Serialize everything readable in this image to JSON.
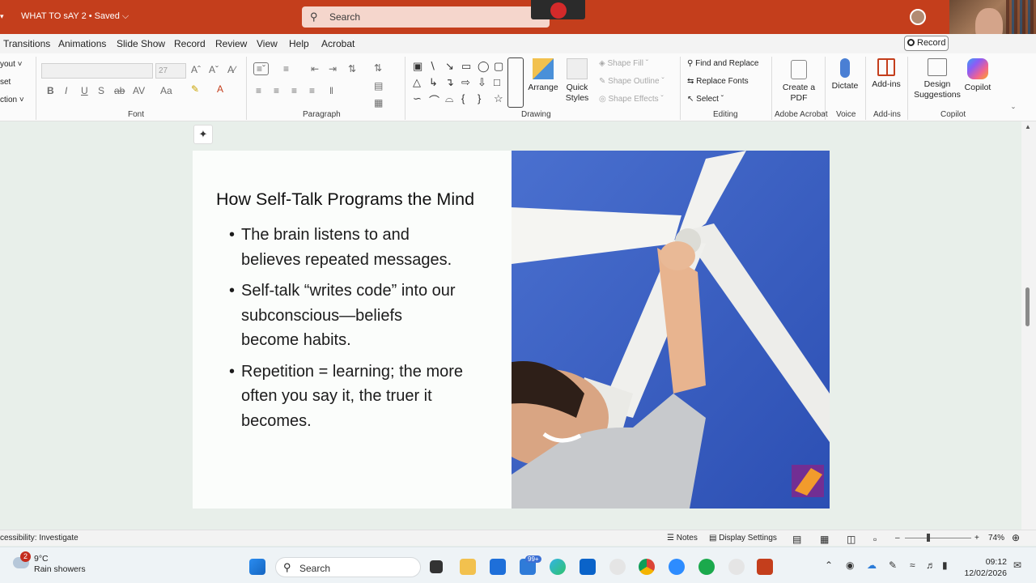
{
  "titlebar": {
    "doc_title": "WHAT TO sAY 2 • Saved ⌵",
    "search_placeholder": "Search",
    "record_label": "Record"
  },
  "tabs": [
    "Transitions",
    "Animations",
    "Slide Show",
    "Record",
    "Review",
    "View",
    "Help",
    "Acrobat"
  ],
  "ribbon": {
    "left_partial": [
      "yout ˅",
      "set",
      "ction ˅"
    ],
    "font_size": "27",
    "groups": {
      "font": "Font",
      "paragraph": "Paragraph",
      "drawing": "Drawing",
      "editing": "Editing",
      "adobe": "Adobe Acrobat",
      "voice": "Voice",
      "addins": "Add-ins",
      "copilot": "Copilot"
    },
    "arrange": "Arrange",
    "quick_styles": "Quick Styles",
    "shape_fill": "Shape Fill",
    "shape_outline": "Shape Outline",
    "shape_effects": "Shape Effects",
    "find_replace": "Find and Replace",
    "replace_fonts": "Replace Fonts",
    "select": "Select",
    "create_pdf": "Create a PDF",
    "dictate": "Dictate",
    "addins_btn": "Add-ins",
    "design_suggestions": "Design Suggestions",
    "copilot_btn": "Copilot"
  },
  "slide": {
    "title": "How Self-Talk Programs the Mind",
    "bullets": [
      "The brain listens to and believes repeated messages.",
      "Self-talk “writes code” into our subconscious—beliefs become habits.",
      "Repetition = learning; the more often you say it, the truer it becomes."
    ]
  },
  "statusbar": {
    "accessibility": "cessibility: Investigate",
    "notes": "Notes",
    "display_settings": "Display Settings",
    "zoom": "74%"
  },
  "taskbar": {
    "temp": "9°C",
    "condition": "Rain showers",
    "weather_badge": "2",
    "search": "Search",
    "mail_badge": "99+",
    "time": "09:12",
    "date": "12/02/2026"
  },
  "colors": {
    "titlebar": "#c43e1c",
    "accent": "#c43e1c",
    "sky": "#3d63c6"
  }
}
